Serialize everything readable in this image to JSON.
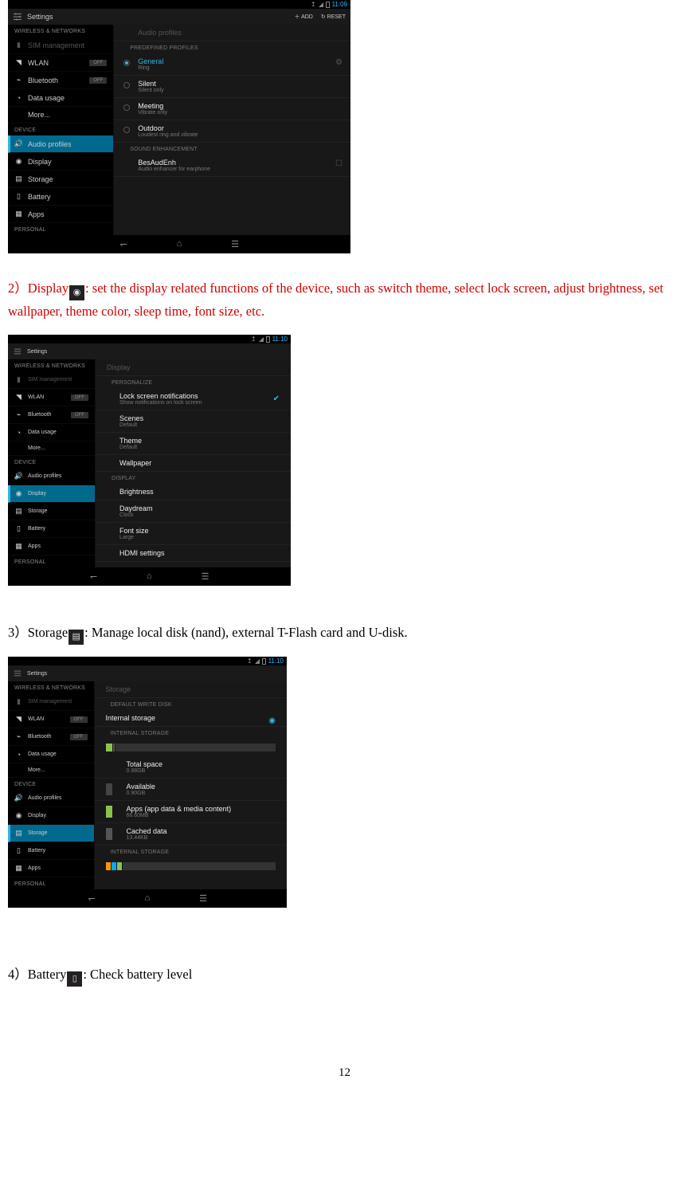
{
  "shot1": {
    "time": "11:09",
    "title": "Settings",
    "titlebar_add": "ADD",
    "titlebar_reset": "RESET",
    "sidebar": {
      "wireless_header": "WIRELESS & NETWORKS",
      "sim": "SIM management",
      "wlan": "WLAN",
      "bluetooth": "Bluetooth",
      "datausage": "Data usage",
      "more": "More...",
      "device_header": "DEVICE",
      "audio": "Audio profiles",
      "display": "Display",
      "storage": "Storage",
      "battery": "Battery",
      "apps": "Apps",
      "personal_header": "PERSONAL",
      "off": "OFF"
    },
    "content": {
      "dim_header": "Audio profiles",
      "predef_header": "PREDEFINED PROFILES",
      "general": "General",
      "general_sub": "Ring",
      "silent": "Silent",
      "silent_sub": "Silent only",
      "meeting": "Meeting",
      "meeting_sub": "Vibrate only",
      "outdoor": "Outdoor",
      "outdoor_sub": "Loudest ring and vibrate",
      "sound_header": "SOUND ENHANCEMENT",
      "bes": "BesAudEnh",
      "bes_sub": "Audio enhancer for earphone"
    }
  },
  "text2": {
    "num": "2）",
    "label": "Display",
    "rest": ": set the display related functions of the device, such as switch theme, select lock screen, adjust brightness, set wallpaper, theme color, sleep time, font size, etc."
  },
  "shot2": {
    "time": "11:10",
    "title": "Settings",
    "content": {
      "dim_header": "Display",
      "personalize_header": "PERSONALIZE",
      "lockscreen": "Lock screen notifications",
      "lockscreen_sub": "Show notifications on lock screen",
      "scenes": "Scenes",
      "scenes_sub": "Default",
      "theme": "Theme",
      "theme_sub": "Default",
      "wallpaper": "Wallpaper",
      "display_header": "DISPLAY",
      "brightness": "Brightness",
      "daydream": "Daydream",
      "daydream_sub": "Clock",
      "fontsize": "Font size",
      "fontsize_sub": "Large",
      "hdmi": "HDMI settings"
    }
  },
  "text3": {
    "num": "3）",
    "label": "Storage",
    "rest": ":  Manage  local  disk  (nand),  external  T-Flash  card  and  U-disk."
  },
  "shot3": {
    "time": "11:10",
    "title": "Settings",
    "content": {
      "dim_header": "Storage",
      "default_header": "DEFAULT WRITE DISK",
      "internal": "Internal storage",
      "internal_header": "INTERNAL STORAGE",
      "total": "Total space",
      "total_sub": "0.98GB",
      "available": "Available",
      "available_sub": "0.90GB",
      "apps": "Apps (app data & media content)",
      "apps_sub": "66.60MB",
      "cached": "Cached data",
      "cached_sub": "13.44KB",
      "internal_header2": "INTERNAL STORAGE"
    }
  },
  "text4": {
    "num": "4）",
    "label": "Battery",
    "rest": ":  Check  battery  level"
  },
  "page_number": "12"
}
